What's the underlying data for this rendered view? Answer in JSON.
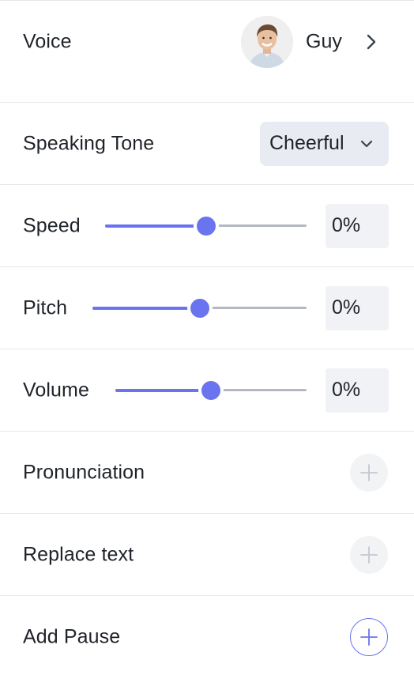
{
  "voice": {
    "label": "Voice",
    "name": "Guy"
  },
  "tone": {
    "label": "Speaking Tone",
    "selected": "Cheerful"
  },
  "speed": {
    "label": "Speed",
    "value": "0%",
    "level": 0.5
  },
  "pitch": {
    "label": "Pitch",
    "value": "0%",
    "level": 0.5
  },
  "volume": {
    "label": "Volume",
    "value": "0%",
    "level": 0.5
  },
  "pronunciation": {
    "label": "Pronunciation"
  },
  "replace_text": {
    "label": "Replace text"
  },
  "add_pause": {
    "label": "Add Pause"
  },
  "colors": {
    "accent": "#6a74ef",
    "track": "#b3b8c1",
    "muted_icon": "#c4c8cf"
  }
}
